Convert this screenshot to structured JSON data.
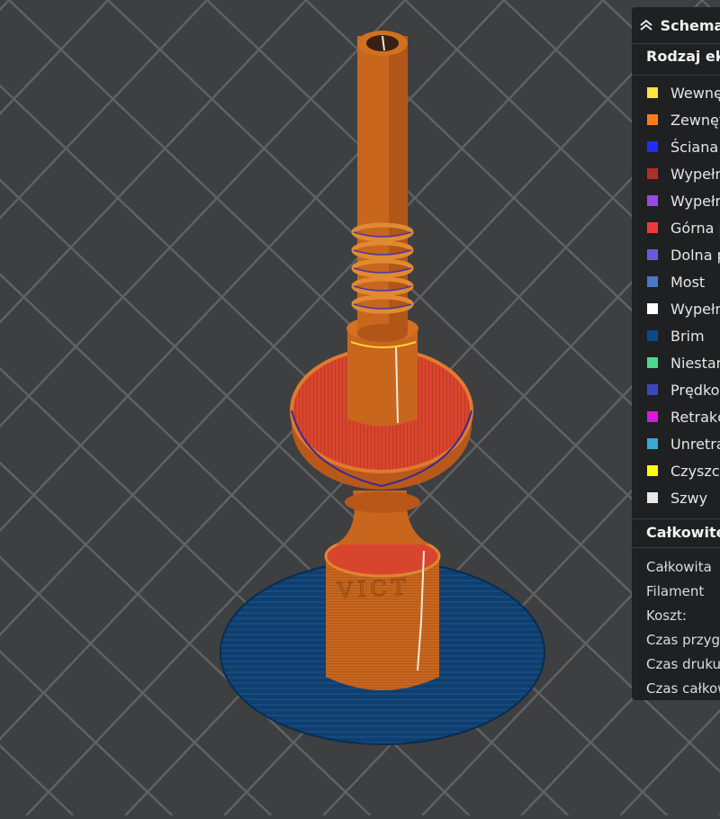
{
  "panel": {
    "title": "Schemat",
    "section_feature_type": "Rodzaj ekstruzji",
    "legend": [
      {
        "label": "Wewnętrzna ściana",
        "color": "#ffe43a"
      },
      {
        "label": "Zewnętrzna ściana",
        "color": "#ff7a1f"
      },
      {
        "label": "Ściana",
        "color": "#1f2dff"
      },
      {
        "label": "Wypełnienie",
        "color": "#b03028"
      },
      {
        "label": "Wypełnienie",
        "color": "#9a4ae0"
      },
      {
        "label": "Górna powierzchnia",
        "color": "#ef3a3a"
      },
      {
        "label": "Dolna powierzchnia",
        "color": "#6a5ad8"
      },
      {
        "label": "Most",
        "color": "#4a78c8"
      },
      {
        "label": "Wypełnienie",
        "color": "#ffffff"
      },
      {
        "label": "Brim",
        "color": "#0a4a8a"
      },
      {
        "label": "Niestandardowe",
        "color": "#4ed88c"
      },
      {
        "label": "Prędkość",
        "color": "#3a48c0"
      },
      {
        "label": "Retrakcja",
        "color": "#d81ad8"
      },
      {
        "label": "Unretrakcja",
        "color": "#3aa8d8"
      },
      {
        "label": "Czyszczenie",
        "color": "#ffff00"
      },
      {
        "label": "Szwy",
        "color": "#e8e8e8"
      }
    ],
    "section_total": "Całkowite",
    "stats": [
      {
        "label": "Całkowita"
      },
      {
        "label": "Filament"
      },
      {
        "label": "Koszt:"
      },
      {
        "label": "Czas przygotowania"
      },
      {
        "label": "Czas druku"
      },
      {
        "label": "Czas całkowity"
      }
    ]
  },
  "viewport": {
    "bed_color": "#3d3f40",
    "grid_color": "#5f6162",
    "model_color": "#c8661e",
    "model_shade": "#a8501a",
    "top_surface_color": "#d8452e",
    "brim_color": "#0f3f6e",
    "embossed_text": "VICT"
  }
}
